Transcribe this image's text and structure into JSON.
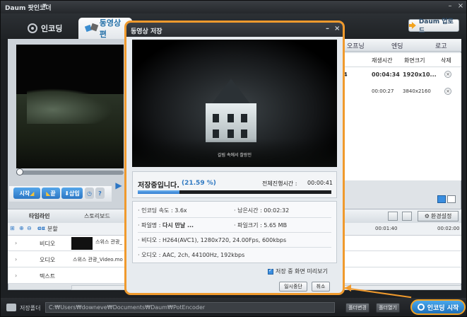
{
  "window": {
    "title": "Daum 팟인코더"
  },
  "tabs": [
    {
      "label": "인코딩",
      "active": false
    },
    {
      "label": "동영상 편",
      "active": true
    }
  ],
  "upgrade_label": "Daum 업로드",
  "list": {
    "head": [
      "오프닝",
      "엔딩",
      "로고"
    ],
    "columns": [
      "재생시간",
      "화면크기",
      "삭제"
    ],
    "rows": [
      {
        "prefix": "4",
        "duration": "00:04:34",
        "size": "1920x10...",
        "bold": true
      },
      {
        "prefix": "",
        "duration": "00:00:27",
        "size": "3840x2160",
        "bold": false
      }
    ]
  },
  "controls": {
    "start": "시작",
    "end": "끝",
    "insert": "삽입",
    "help": "?"
  },
  "timeline": {
    "tabs": [
      "타임라인",
      "스토리보드"
    ],
    "zoom_label": "분할",
    "env_label": "환경설정",
    "ruler": [
      "00:01:40",
      "00:02:00"
    ],
    "tracks": [
      "비디오",
      "오디오",
      "텍스트"
    ],
    "clip_video": "스위스 관광_",
    "clip_audio": "스위스 관광_Video.mo"
  },
  "status": {
    "folder_label": "저장폴더",
    "folder_path": "C:₩Users₩downeve₩Documents₩Daum₩PotEncoder",
    "change_folder": "폴더변경",
    "open_folder": "폴더열기",
    "encode_start": "인코딩 시작"
  },
  "dialog": {
    "title": "동영상 저장",
    "subtitle": "갈림 속에서 찰랑인",
    "saving_label": "저장중입니다.",
    "saving_pct": "(21.59 %)",
    "progress_fraction": 0.2159,
    "total_label": "전체진행시간 :",
    "total_value": "00:00:41",
    "speed_label": "· 인코딩 속도 : 3.6x",
    "remaining_label": "· 남은시간 : 00:02:32",
    "filename_prefix": "· 파일명 :",
    "filename": "다시 만날 ...",
    "filesize_label": "· 파일크기 : 5.65 MB",
    "video_label": "· 비디오 : H264(AVC1), 1280x720, 24.00Fps, 600kbps",
    "audio_label": "· 오디오 : AAC, 2ch, 44100Hz, 192kbps",
    "preview_label": "저장 중 화면 미리보기",
    "pause": "일시중단",
    "cancel": "취소"
  },
  "colors": {
    "accent_orange": "#f09a2d",
    "accent_blue": "#2f79c2"
  }
}
